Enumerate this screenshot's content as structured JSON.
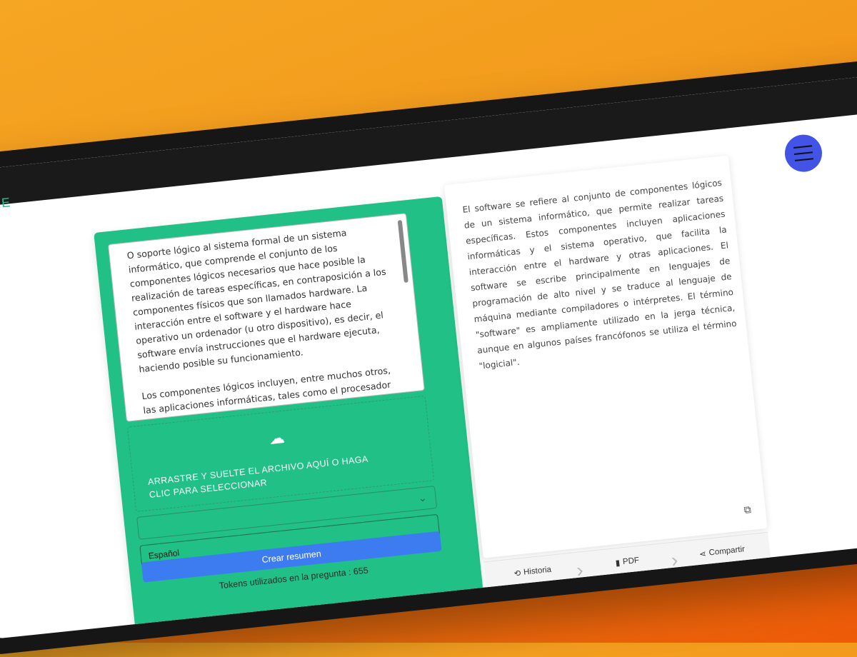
{
  "brand_fragment": "ME",
  "input_text": [
    "O soporte lógico al sistema formal de un sistema informático, que comprende el conjunto de los componentes lógicos necesarios que hace posible la realización de tareas específicas, en contraposición a los componentes físicos que son llamados hardware. La interacción entre el software y el hardware hace operativo un ordenador (u otro dispositivo), es decir, el software envía instrucciones que el hardware ejecuta, haciendo posible su funcionamiento.",
    "Los componentes lógicos incluyen, entre muchos otros, las aplicaciones informáticas, tales como el procesador de texto, que permite al usuario realizar todas las tareas concernientes a la edición de textos; el llamado software de sistema, tal como el sistema operativo, que básicamente permite al resto de los programas funcionar adecuadamente, facilitando también la interacción entre los componentes físicos y el resto de las aplicaciones, y proporcionando una interfaz con el usuario.2"
  ],
  "dropzone_label": "ARRASTRE Y SUELTE EL ARCHIVO AQUÍ O HAGA CLIC PARA SELECCIONAR",
  "language_value": "Español",
  "create_button": "Crear resumen",
  "tokens_text": "Tokens utilizados en la pregunta : 655",
  "summary_text": "El software se refiere al conjunto de componentes lógicos de un sistema informático, que permite realizar tareas específicas. Estos componentes incluyen aplicaciones informáticas y el sistema operativo, que facilita la interacción entre el hardware y otras aplicaciones. El software se escribe principalmente en lenguajes de programación de alto nivel y se traduce al lenguaje de máquina mediante compiladores o intérpretes. El término \"software\" es ampliamente utilizado en la jerga técnica, aunque en algunos países francófonos se utiliza el término \"logicial\".",
  "actions": {
    "history": "Historia",
    "pdf": "PDF",
    "share": "Compartir"
  },
  "colors": {
    "card": "#21c087",
    "button": "#3d7cf0",
    "menu": "#4154e6"
  },
  "icons": {
    "upload": "cloud-upload-icon",
    "copy": "copy-icon",
    "history": "history-icon",
    "pdf": "file-icon",
    "share": "share-icon",
    "menu": "hamburger-icon"
  }
}
